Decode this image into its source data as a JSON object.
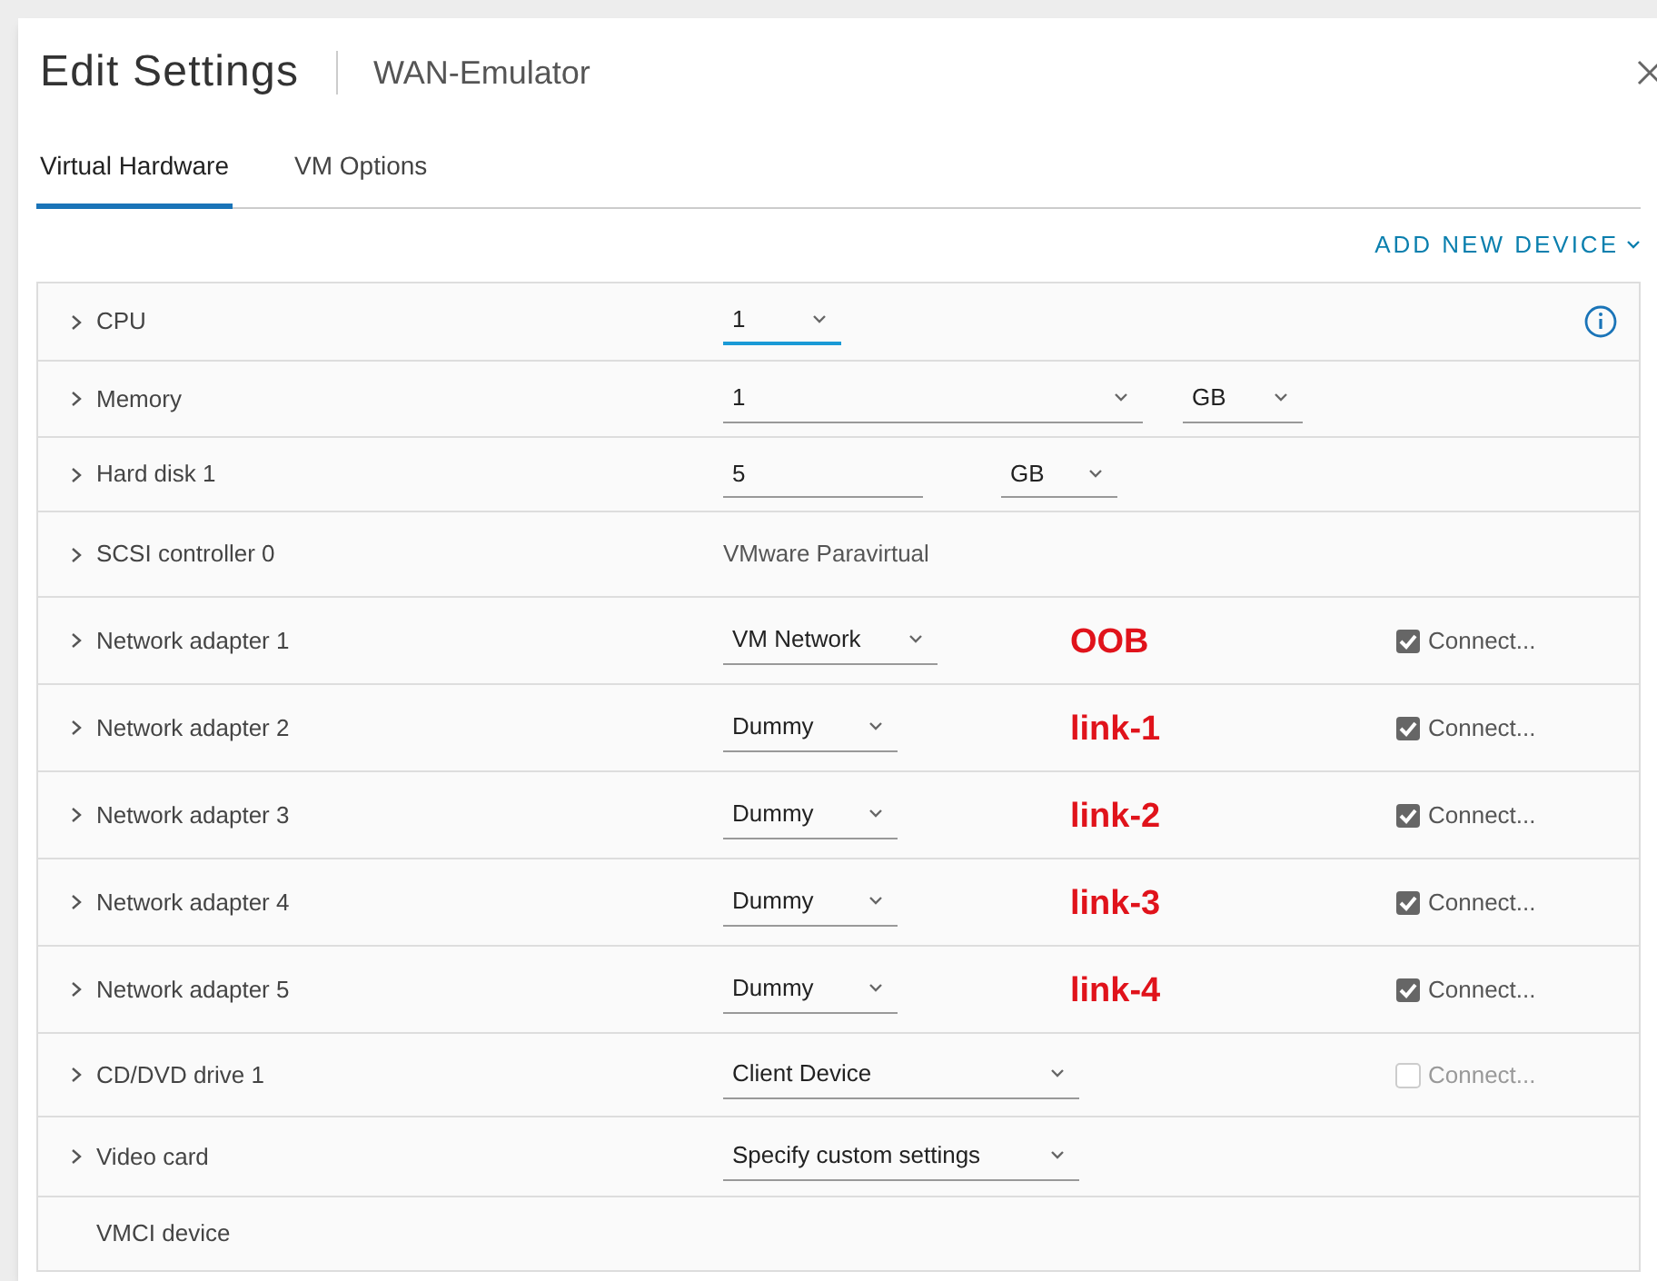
{
  "dialog": {
    "title": "Edit Settings",
    "subtitle": "WAN-Emulator"
  },
  "tabs": [
    {
      "label": "Virtual Hardware",
      "selected": true
    },
    {
      "label": "VM Options",
      "selected": false
    }
  ],
  "add_device": {
    "label": "ADD NEW DEVICE"
  },
  "rows": [
    {
      "label": "CPU",
      "expandable": true,
      "control": {
        "kind": "select",
        "value": "1",
        "focused": true
      },
      "info": true
    },
    {
      "label": "Memory",
      "expandable": true,
      "control": {
        "kind": "select",
        "value": "1",
        "focused": false
      },
      "unit": "GB"
    },
    {
      "label": "Hard disk 1",
      "expandable": true,
      "control": {
        "kind": "input",
        "value": "5",
        "focused": false
      },
      "unit": "GB"
    },
    {
      "label": "SCSI controller 0",
      "expandable": true,
      "control": {
        "kind": "text",
        "value": "VMware Paravirtual"
      }
    },
    {
      "label": "Network adapter 1",
      "expandable": true,
      "control": {
        "kind": "select",
        "value": "VM Network",
        "focused": false
      },
      "note": "OOB",
      "connect": {
        "label": "Connect...",
        "checked": true,
        "disabled": false
      }
    },
    {
      "label": "Network adapter 2",
      "expandable": true,
      "control": {
        "kind": "select",
        "value": "Dummy",
        "focused": false
      },
      "note": "link-1",
      "connect": {
        "label": "Connect...",
        "checked": true,
        "disabled": false
      }
    },
    {
      "label": "Network adapter 3",
      "expandable": true,
      "control": {
        "kind": "select",
        "value": "Dummy",
        "focused": false
      },
      "note": "link-2",
      "connect": {
        "label": "Connect...",
        "checked": true,
        "disabled": false
      }
    },
    {
      "label": "Network adapter 4",
      "expandable": true,
      "control": {
        "kind": "select",
        "value": "Dummy",
        "focused": false
      },
      "note": "link-3",
      "connect": {
        "label": "Connect...",
        "checked": true,
        "disabled": false
      }
    },
    {
      "label": "Network adapter 5",
      "expandable": true,
      "control": {
        "kind": "select",
        "value": "Dummy",
        "focused": false
      },
      "note": "link-4",
      "connect": {
        "label": "Connect...",
        "checked": true,
        "disabled": false
      }
    },
    {
      "label": "CD/DVD drive 1",
      "expandable": true,
      "control": {
        "kind": "select",
        "value": "Client Device",
        "focused": false
      },
      "connect": {
        "label": "Connect...",
        "checked": false,
        "disabled": true
      }
    },
    {
      "label": "Video card",
      "expandable": true,
      "control": {
        "kind": "select",
        "value": "Specify custom settings",
        "focused": false
      }
    },
    {
      "label": "VMCI device",
      "expandable": false
    }
  ]
}
